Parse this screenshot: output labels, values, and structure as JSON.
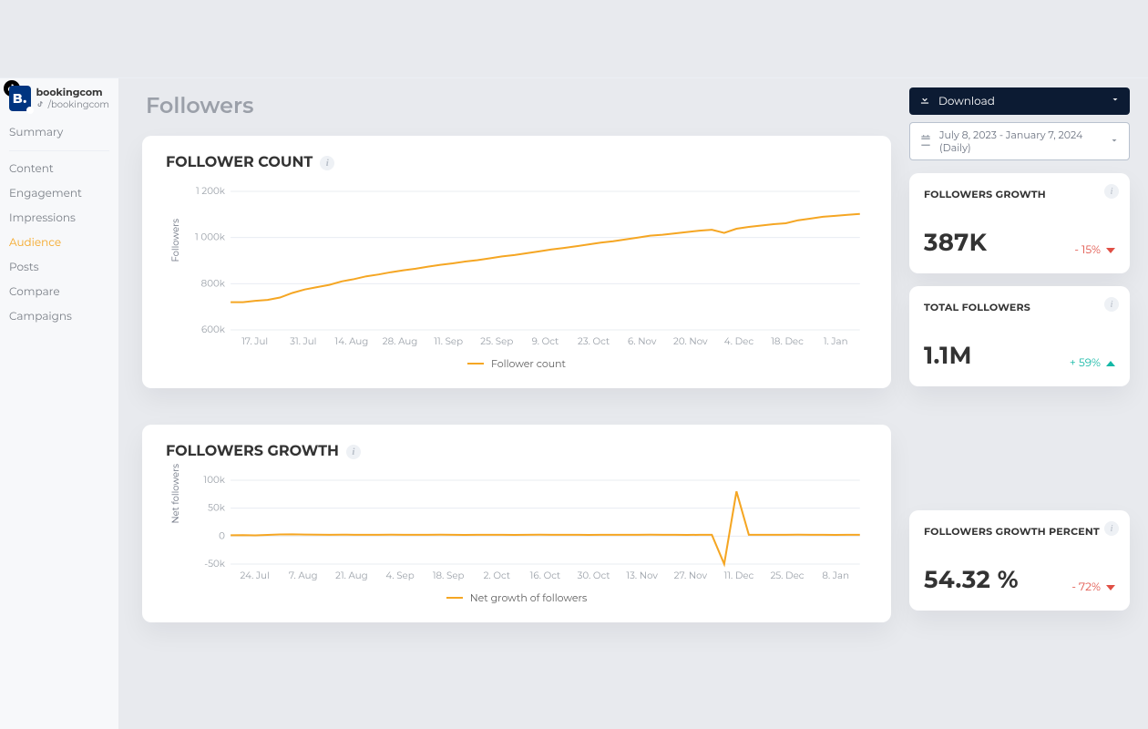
{
  "account": {
    "name": "bookingcom",
    "platform_handle": "/bookingcom",
    "avatar_text": "B."
  },
  "sidebar": {
    "items": [
      {
        "label": "Summary",
        "active": false
      },
      {
        "label": "Content",
        "active": false
      },
      {
        "label": "Engagement",
        "active": false
      },
      {
        "label": "Impressions",
        "active": false
      },
      {
        "label": "Audience",
        "active": true
      },
      {
        "label": "Posts",
        "active": false
      },
      {
        "label": "Compare",
        "active": false
      },
      {
        "label": "Campaigns",
        "active": false
      }
    ]
  },
  "page": {
    "title": "Followers"
  },
  "controls": {
    "download_label": "Download",
    "date_range": "July 8, 2023 - January 7, 2024 (Daily)"
  },
  "cards": {
    "follower_count": {
      "title": "FOLLOWER COUNT",
      "legend": "Follower count",
      "y_axis_label": "Followers"
    },
    "followers_growth": {
      "title": "FOLLOWERS GROWTH",
      "legend": "Net growth of followers",
      "y_axis_label": "Net followers"
    }
  },
  "kpis": {
    "growth": {
      "title": "FOLLOWERS GROWTH",
      "value": "387K",
      "delta": "- 15%",
      "trend": "down"
    },
    "total": {
      "title": "TOTAL FOLLOWERS",
      "value": "1.1M",
      "delta": "+ 59%",
      "trend": "up"
    },
    "growth_pct": {
      "title": "FOLLOWERS GROWTH PERCENT",
      "value": "54.32 %",
      "delta": "- 72%",
      "trend": "down"
    }
  },
  "chart_data": [
    {
      "id": "follower_count",
      "type": "line",
      "xlabel": "",
      "ylabel": "Followers",
      "ylim": [
        600000,
        1200000
      ],
      "y_ticks": [
        {
          "v": 600000,
          "label": "600k"
        },
        {
          "v": 800000,
          "label": "800k"
        },
        {
          "v": 1000000,
          "label": "1 000k"
        },
        {
          "v": 1200000,
          "label": "1 200k"
        }
      ],
      "x_ticks": [
        "17. Jul",
        "31. Jul",
        "14. Aug",
        "28. Aug",
        "11. Sep",
        "25. Sep",
        "9. Oct",
        "23. Oct",
        "6. Nov",
        "20. Nov",
        "4. Dec",
        "18. Dec",
        "1. Jan"
      ],
      "legend": [
        "Follower count"
      ],
      "series": [
        {
          "name": "Follower count",
          "values": [
            720000,
            720000,
            726000,
            730000,
            740000,
            760000,
            775000,
            785000,
            795000,
            810000,
            820000,
            832000,
            840000,
            850000,
            858000,
            865000,
            874000,
            882000,
            888000,
            896000,
            902000,
            910000,
            918000,
            924000,
            932000,
            940000,
            948000,
            955000,
            962000,
            970000,
            978000,
            984000,
            992000,
            1000000,
            1008000,
            1012000,
            1018000,
            1024000,
            1030000,
            1034000,
            1020000,
            1038000,
            1046000,
            1052000,
            1058000,
            1062000,
            1075000,
            1082000,
            1090000,
            1094000,
            1098000,
            1102000
          ]
        }
      ]
    },
    {
      "id": "followers_growth",
      "type": "line",
      "xlabel": "",
      "ylabel": "Net followers",
      "ylim": [
        -50000,
        100000
      ],
      "y_ticks": [
        {
          "v": -50000,
          "label": "-50k"
        },
        {
          "v": 0,
          "label": "0"
        },
        {
          "v": 50000,
          "label": "50k"
        },
        {
          "v": 100000,
          "label": "100k"
        }
      ],
      "x_ticks": [
        "24. Jul",
        "7. Aug",
        "21. Aug",
        "4. Sep",
        "18. Sep",
        "2. Oct",
        "16. Oct",
        "30. Oct",
        "13. Nov",
        "27. Nov",
        "11. Dec",
        "25. Dec",
        "8. Jan"
      ],
      "legend": [
        "Net growth of followers"
      ],
      "series": [
        {
          "name": "Net growth of followers",
          "values": [
            1500,
            1700,
            1400,
            2200,
            3000,
            3200,
            2800,
            2500,
            2400,
            2600,
            2400,
            2400,
            2300,
            2500,
            2400,
            2300,
            2400,
            2500,
            2300,
            2200,
            2400,
            2300,
            2300,
            2200,
            2400,
            2500,
            2300,
            2400,
            2300,
            2200,
            2400,
            2300,
            2400,
            2300,
            2500,
            2400,
            2300,
            2200,
            2400,
            2300,
            -50000,
            80000,
            2400,
            2300,
            2400,
            2300,
            2500,
            2400,
            2300,
            2200,
            2400,
            2300
          ]
        }
      ]
    }
  ]
}
